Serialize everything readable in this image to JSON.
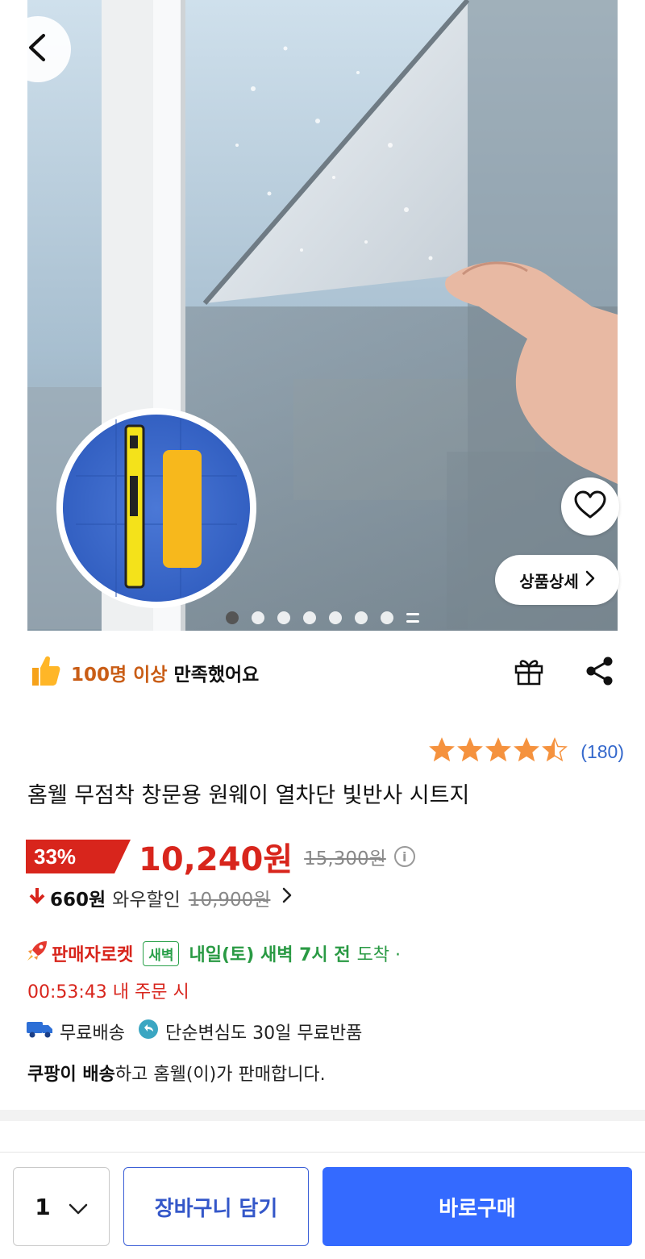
{
  "hero": {
    "image_alt": "",
    "detail_button_label": "상품상세",
    "image_count": 7,
    "active_image_index": 0
  },
  "satisfaction": {
    "highlight": "100명 이상",
    "rest": "만족했어요"
  },
  "rating": {
    "stars": 4.5,
    "count": "(180)",
    "star_color": "#f5923e"
  },
  "product": {
    "title": "홈웰 무점착 창문용 원웨이 열차단 빛반사 시트지"
  },
  "price": {
    "discount": "33%",
    "sale_price": "10,240원",
    "original_price": "15,300원",
    "wow_amount": "660원",
    "wow_label": "와우할인",
    "wow_original": "10,900원",
    "accent_color": "#d8251c"
  },
  "delivery": {
    "rocket_label": "판매자로켓",
    "dawn_badge": "새벽",
    "arrival_strong": "내일(토) 새벽 7시 전",
    "arrival_rest": "도착 ·",
    "countdown": "00:53:43 내 주문 시",
    "free_shipping": "무료배송",
    "free_return": "단순변심도 30일 무료반품",
    "seller_strong": "쿠팡이 배송",
    "seller_rest": "하고 홈웰(이)가 판매합니다."
  },
  "bottom_bar": {
    "quantity": "1",
    "cart_label": "장바구니 담기",
    "buy_label": "바로구매",
    "buy_color": "#346aff"
  }
}
